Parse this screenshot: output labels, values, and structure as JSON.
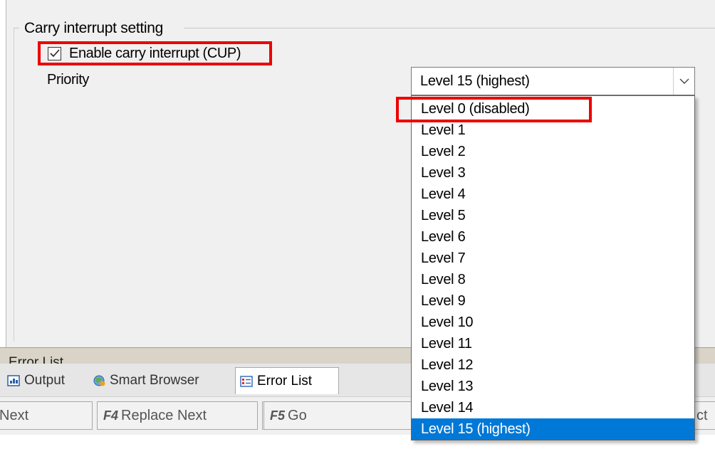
{
  "group": {
    "title": "Carry interrupt setting"
  },
  "checkbox": {
    "label": "Enable carry interrupt (CUP)",
    "checked": true
  },
  "priority": {
    "label": "Priority",
    "selected": "Level 15 (highest)",
    "options": [
      "Level 0 (disabled)",
      "Level 1",
      "Level 2",
      "Level 3",
      "Level 4",
      "Level 5",
      "Level 6",
      "Level 7",
      "Level 8",
      "Level 9",
      "Level 10",
      "Level 11",
      "Level 12",
      "Level 13",
      "Level 14",
      "Level 15 (highest)"
    ]
  },
  "dock": {
    "title": "Error List",
    "tabs": [
      {
        "label": "Output",
        "icon": "output-icon"
      },
      {
        "label": "Smart Browser",
        "icon": "smart-browser-icon"
      },
      {
        "label": "Error List",
        "icon": "error-list-icon",
        "active": true
      }
    ]
  },
  "toolbar": {
    "next_label": "Next",
    "replace_key": "F4",
    "replace_label": "Replace Next",
    "go_key": "F5",
    "go_label": "Go",
    "right_fragment": "ct"
  },
  "colors": {
    "highlight": "#e00000",
    "selection": "#0078d7"
  }
}
